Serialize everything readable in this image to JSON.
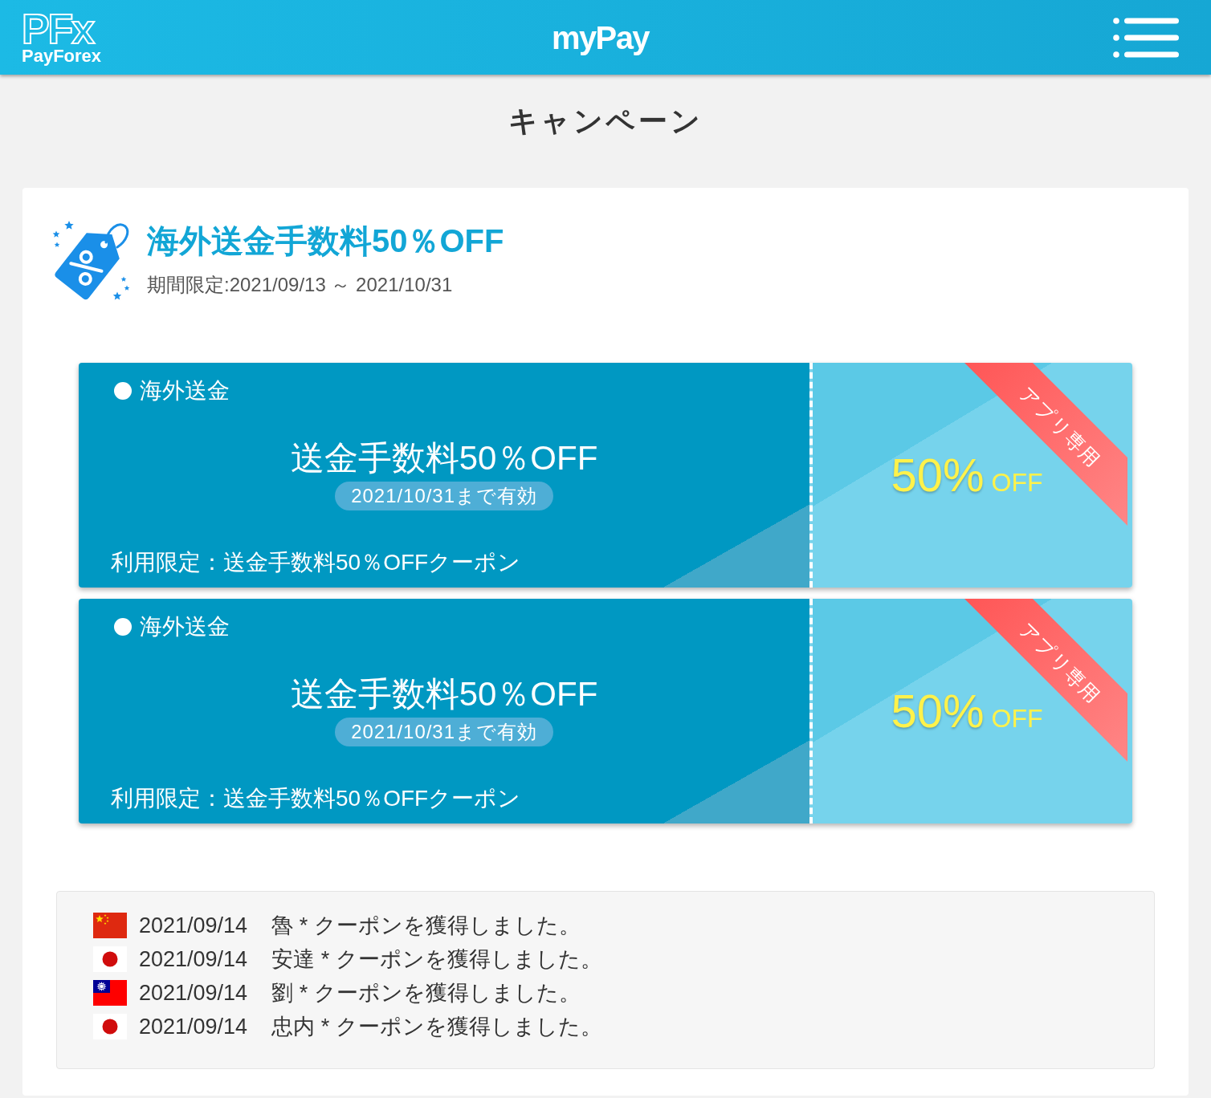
{
  "header": {
    "logo_mark": "PFx",
    "logo_text": "PayForex",
    "title": "myPay"
  },
  "page_title": "キャンペーン",
  "campaign": {
    "title": "海外送金手数料50％OFF",
    "period": "期間限定:2021/09/13 ～ 2021/10/31",
    "coupons": [
      {
        "category": "海外送金",
        "title": "送金手数料50％OFF",
        "validity": "2021/10/31まで有効",
        "restriction": "利用限定：送金手数料50％OFFクーポン",
        "discount": "50%",
        "discount_suffix": "OFF",
        "ribbon": "アプリ専用"
      },
      {
        "category": "海外送金",
        "title": "送金手数料50％OFF",
        "validity": "2021/10/31まで有効",
        "restriction": "利用限定：送金手数料50％OFFクーポン",
        "discount": "50%",
        "discount_suffix": "OFF",
        "ribbon": "アプリ専用"
      }
    ],
    "activity": [
      {
        "kind": "china",
        "date": "2021/09/14",
        "message": "魯 * クーポンを獲得しました。"
      },
      {
        "kind": "japan",
        "date": "2021/09/14",
        "message": "安達 * クーポンを獲得しました。"
      },
      {
        "kind": "taiwan",
        "date": "2021/09/14",
        "message": "劉 * クーポンを獲得しました。"
      },
      {
        "kind": "japan",
        "date": "2021/09/14",
        "message": "忠内 * クーポンを獲得しました。"
      }
    ]
  }
}
